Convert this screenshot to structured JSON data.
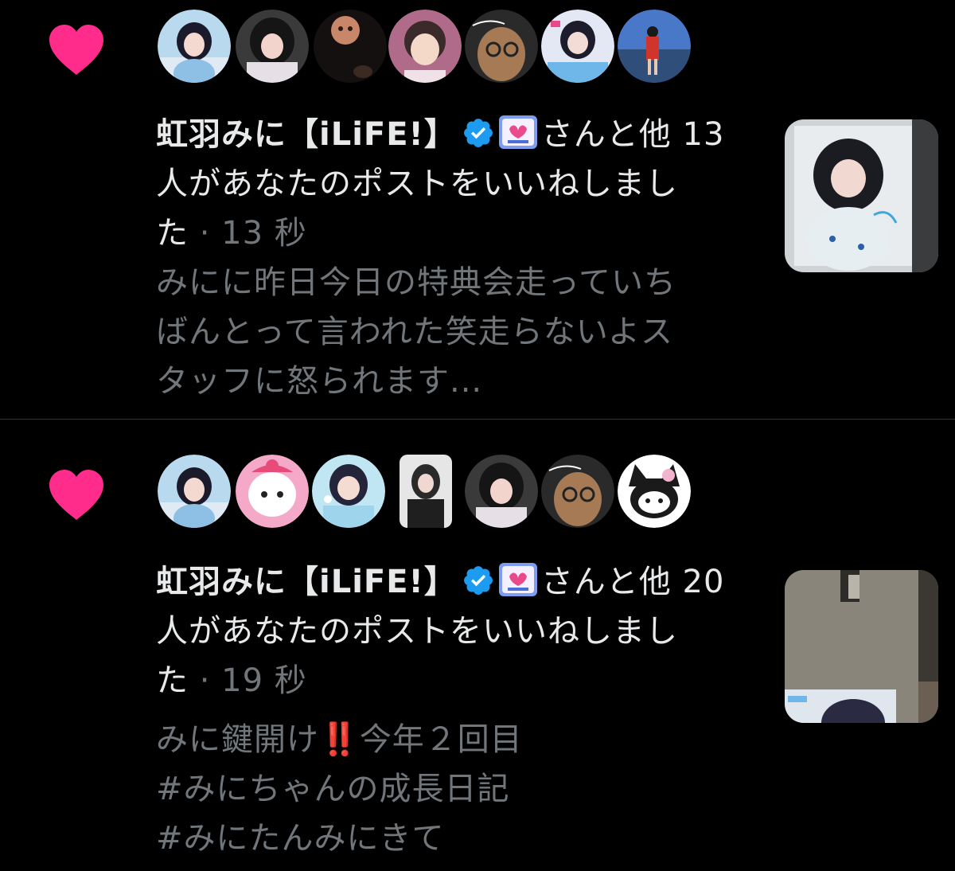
{
  "colors": {
    "background": "#000000",
    "heart": "#ff2c8b",
    "text_primary": "#e7e9ea",
    "text_secondary": "#71767b",
    "verified": "#1d9bf0",
    "divider": "#2f3336"
  },
  "notifications": [
    {
      "icon": "heart-icon",
      "avatars": [
        "avatar-1",
        "avatar-2",
        "avatar-3",
        "avatar-4",
        "avatar-5",
        "avatar-6",
        "avatar-7"
      ],
      "lines": {
        "l1_name": "虹羽みに【iLiFE!】",
        "l1_rest": "さんと他 13",
        "l2": "人があなたのポストをいいねしまし",
        "l3_start": "た",
        "l3_sep": " · ",
        "l3_time": "13 秒"
      },
      "preview": [
        "みにに昨日今日の特典会走っていち",
        "ばんとって言われた笑走らないよス",
        "タッフに怒られます..."
      ]
    },
    {
      "icon": "heart-icon",
      "avatars": [
        "avatar-1",
        "avatar-2",
        "avatar-3",
        "avatar-4",
        "avatar-5",
        "avatar-6",
        "avatar-7"
      ],
      "lines": {
        "l1_name": "虹羽みに【iLiFE!】",
        "l1_rest": "さんと他 20",
        "l2": "人があなたのポストをいいねしまし",
        "l3_start": "た",
        "l3_sep": " · ",
        "l3_time": "19 秒"
      },
      "preview": {
        "line1_a": "みに鍵開け",
        "line1_mark": "‼️",
        "line1_b": "今年２回目",
        "line2": "#みにちゃんの成長日記",
        "line3": " #みにたんみにきて"
      }
    }
  ]
}
